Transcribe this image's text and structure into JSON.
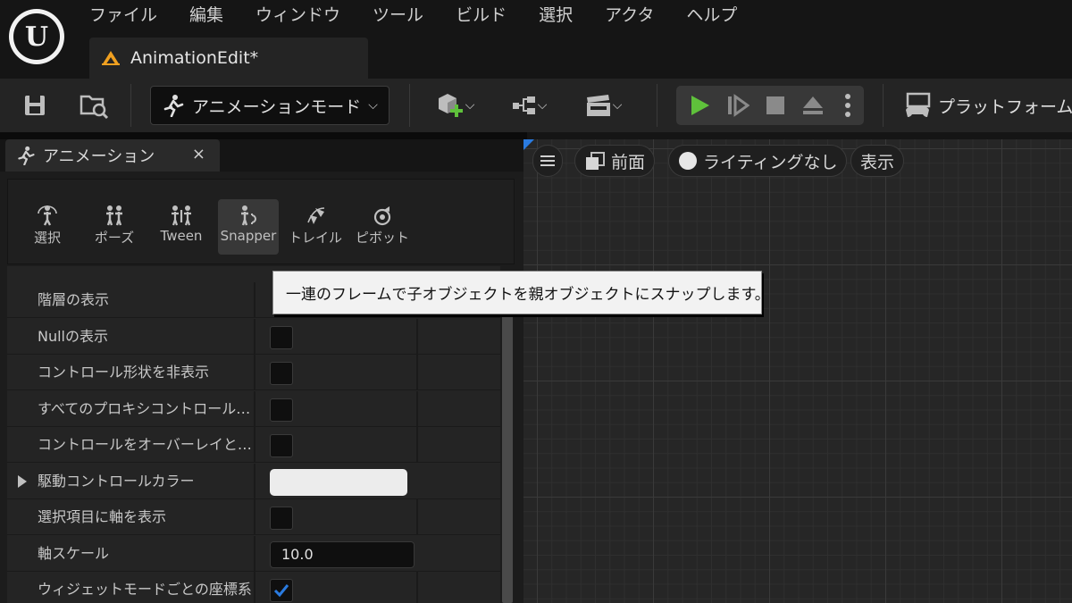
{
  "menu": [
    "ファイル",
    "編集",
    "ウィンドウ",
    "ツール",
    "ビルド",
    "選択",
    "アクタ",
    "ヘルプ"
  ],
  "document_tab": {
    "label": "AnimationEdit*"
  },
  "toolbar": {
    "mode_label": "アニメーションモード",
    "platform_label": "プラットフォーム"
  },
  "panel": {
    "tab_label": "アニメーション",
    "close_glyph": "×",
    "tools": [
      {
        "label": "選択",
        "icon": "select-icon"
      },
      {
        "label": "ポーズ",
        "icon": "pose-icon"
      },
      {
        "label": "Tween",
        "icon": "tween-icon"
      },
      {
        "label": "Snapper",
        "icon": "snapper-icon"
      },
      {
        "label": "トレイル",
        "icon": "trail-icon"
      },
      {
        "label": "ピボット",
        "icon": "pivot-icon"
      }
    ],
    "properties": [
      {
        "name": "階層の表示",
        "type": "none"
      },
      {
        "name": "Nullの表示",
        "type": "checkbox",
        "checked": false
      },
      {
        "name": "コントロール形状を非表示",
        "type": "checkbox",
        "checked": false
      },
      {
        "name": "すべてのプロキシコントロールを…",
        "type": "checkbox",
        "checked": false
      },
      {
        "name": "コントロールをオーバーレイとし…",
        "type": "checkbox",
        "checked": false
      },
      {
        "name": "駆動コントロールカラー",
        "type": "color",
        "color": "#ececec"
      },
      {
        "name": "選択項目に軸を表示",
        "type": "checkbox",
        "checked": false
      },
      {
        "name": "軸スケール",
        "type": "number",
        "value": "10.0"
      },
      {
        "name": "ウィジェットモードごとの座標系",
        "type": "checkbox",
        "checked": true
      }
    ]
  },
  "viewport": {
    "view_label": "前面",
    "lighting_label": "ライティングなし",
    "show_label": "表示"
  },
  "tooltip": "一連のフレームで子オブジェクトを親オブジェクトにスナップします。",
  "colors": {
    "accent": "#2a7be0",
    "play": "#5fc13b",
    "logo": "#f2f2f2"
  }
}
